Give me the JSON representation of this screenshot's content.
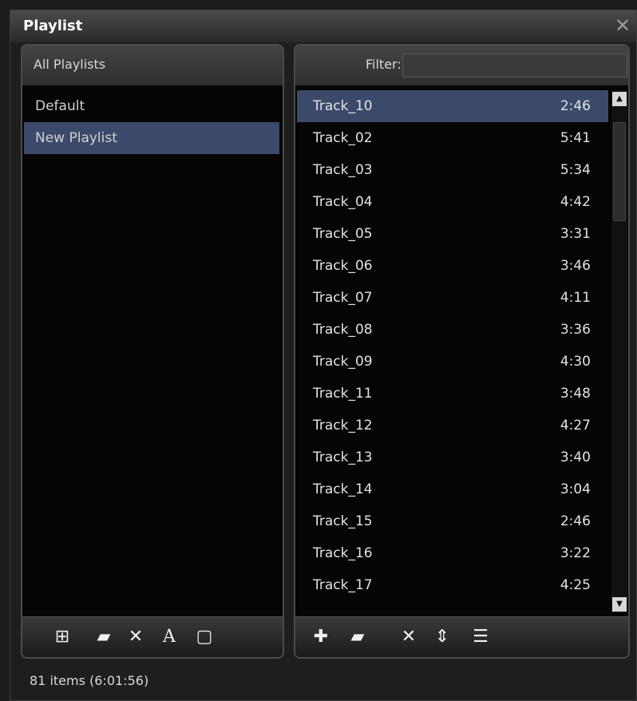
{
  "window": {
    "title": "Playlist",
    "close_icon": "close-icon"
  },
  "left_panel": {
    "header": "All Playlists",
    "items": [
      {
        "label": "Default",
        "selected": false
      },
      {
        "label": "New Playlist",
        "selected": true
      }
    ],
    "toolbar_icons": [
      "new-playlist-icon",
      "open-folder-icon",
      "delete-icon",
      "rename-icon",
      "save-icon"
    ]
  },
  "right_panel": {
    "filter_label": "Filter:",
    "filter_value": "",
    "tracks": [
      {
        "name": "Track_10",
        "duration": "2:46",
        "selected": true
      },
      {
        "name": "Track_02",
        "duration": "5:41"
      },
      {
        "name": "Track_03",
        "duration": "5:34"
      },
      {
        "name": "Track_04",
        "duration": "4:42"
      },
      {
        "name": "Track_05",
        "duration": "3:31"
      },
      {
        "name": "Track_06",
        "duration": "3:46"
      },
      {
        "name": "Track_07",
        "duration": "4:11"
      },
      {
        "name": "Track_08",
        "duration": "3:36"
      },
      {
        "name": "Track_09",
        "duration": "4:30"
      },
      {
        "name": "Track_11",
        "duration": "3:48"
      },
      {
        "name": "Track_12",
        "duration": "4:27"
      },
      {
        "name": "Track_13",
        "duration": "3:40"
      },
      {
        "name": "Track_14",
        "duration": "3:04"
      },
      {
        "name": "Track_15",
        "duration": "2:46"
      },
      {
        "name": "Track_16",
        "duration": "3:22"
      },
      {
        "name": "Track_17",
        "duration": "4:25"
      }
    ],
    "toolbar_icons": [
      "add-icon",
      "add-folder-icon",
      "remove-icon",
      "sort-icon",
      "list-icon"
    ]
  },
  "status": "81 items (6:01:56)"
}
